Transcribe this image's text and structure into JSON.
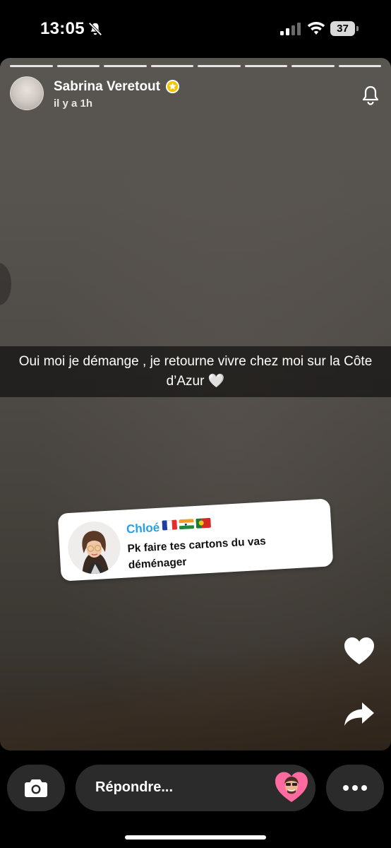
{
  "status_bar": {
    "time": "13:05",
    "battery": "37"
  },
  "story": {
    "progress_segments": 8,
    "username": "Sabrina Veretout",
    "timestamp": "il y a 1h",
    "caption": "Oui moi je démange , je retourne vivre chez moi sur la Côte d’Azur 🤍"
  },
  "reply_sticker": {
    "name": "Chloé",
    "message": "Pk faire tes cartons du vas déménager"
  },
  "bottom_bar": {
    "reply_placeholder": "Répondre..."
  },
  "colors": {
    "reply_name": "#24a0e6",
    "button_bg": "#2b2b2b",
    "heart_pink": "#ff6aa0"
  },
  "icons": [
    "bell-slash-icon",
    "signal-icon",
    "wifi-icon",
    "battery-icon",
    "verified-star-icon",
    "notification-bell-icon",
    "heart-icon",
    "share-arrow-icon",
    "camera-icon",
    "more-dots-icon"
  ]
}
